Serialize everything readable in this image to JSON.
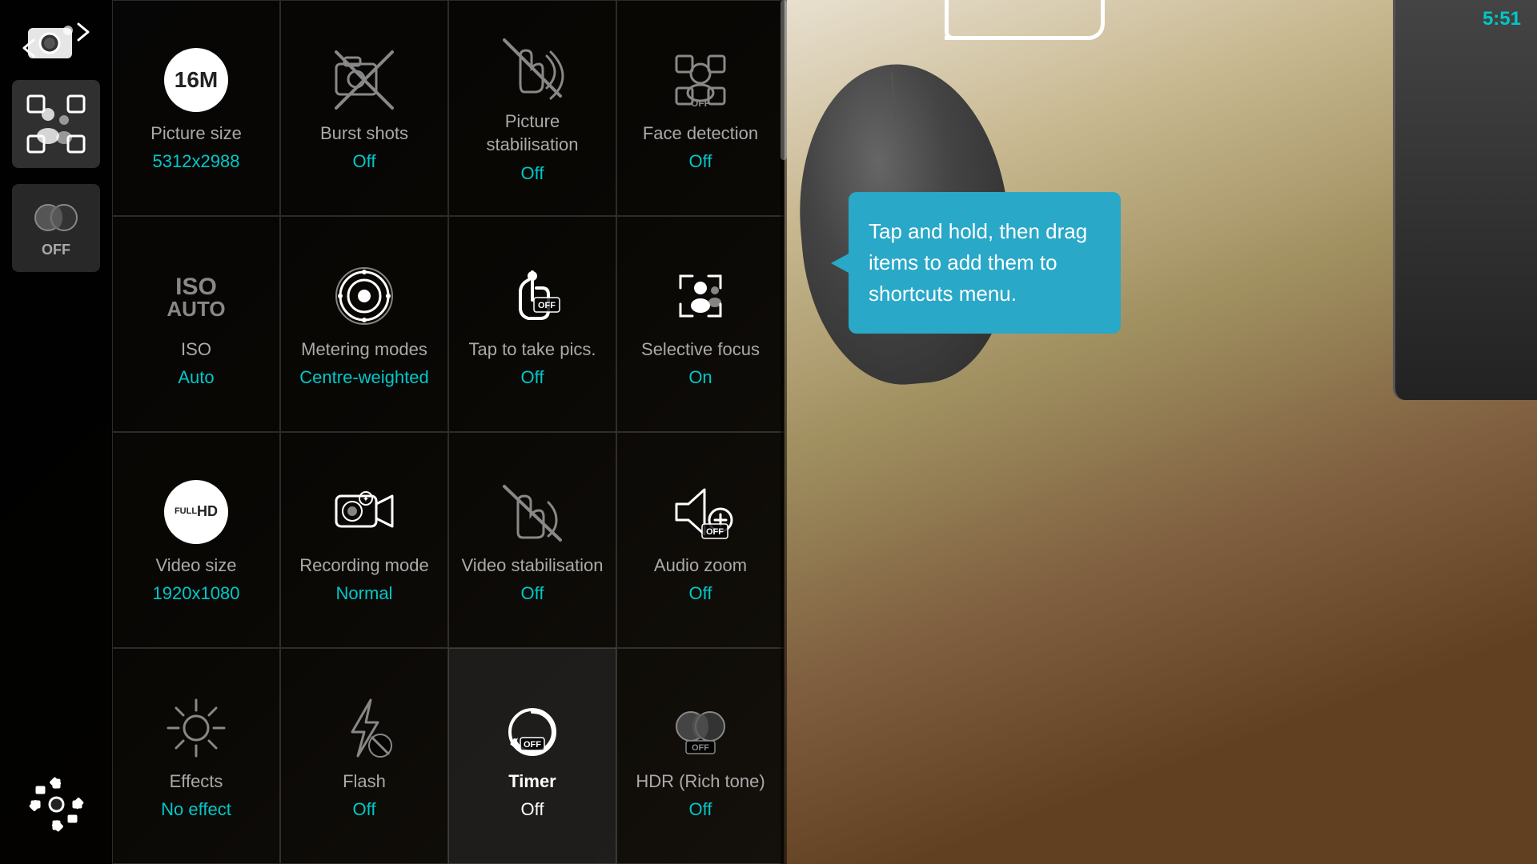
{
  "sidebar": {
    "camera_switch_label": "camera-switch",
    "effects_label": "OFF",
    "settings_label": "settings"
  },
  "grid": {
    "cells": [
      {
        "id": "picture-size",
        "label": "Picture size",
        "value": "5312x2988",
        "icon_type": "16m-badge",
        "value_color": "cyan"
      },
      {
        "id": "burst-shots",
        "label": "Burst shots",
        "value": "Off",
        "icon_type": "burst-shots-off",
        "value_color": "cyan"
      },
      {
        "id": "picture-stabilisation",
        "label": "Picture stabilisation",
        "value": "Off",
        "icon_type": "stabilisation-off",
        "value_color": "cyan"
      },
      {
        "id": "face-detection",
        "label": "Face detection",
        "value": "Off",
        "icon_type": "face-detection-off",
        "value_color": "cyan"
      },
      {
        "id": "iso",
        "label": "ISO",
        "value": "Auto",
        "icon_type": "iso-auto",
        "value_color": "cyan"
      },
      {
        "id": "metering-modes",
        "label": "Metering modes",
        "value": "Centre-weighted",
        "icon_type": "metering",
        "value_color": "cyan"
      },
      {
        "id": "tap-to-take",
        "label": "Tap to take pics.",
        "value": "Off",
        "icon_type": "tap-off",
        "value_color": "cyan"
      },
      {
        "id": "selective-focus",
        "label": "Selective focus",
        "value": "On",
        "icon_type": "selective-focus-on",
        "value_color": "cyan"
      },
      {
        "id": "video-size",
        "label": "Video size",
        "value": "1920x1080",
        "icon_type": "full-hd",
        "value_color": "cyan"
      },
      {
        "id": "recording-mode",
        "label": "Recording mode",
        "value": "Normal",
        "icon_type": "recording",
        "value_color": "cyan"
      },
      {
        "id": "video-stabilisation",
        "label": "Video stabilisation",
        "value": "Off",
        "icon_type": "video-stab-off",
        "value_color": "cyan"
      },
      {
        "id": "audio-zoom",
        "label": "Audio zoom",
        "value": "Off",
        "icon_type": "audio-zoom-off",
        "value_color": "cyan"
      },
      {
        "id": "effects",
        "label": "Effects",
        "value": "No effect",
        "icon_type": "effects-off",
        "value_color": "cyan"
      },
      {
        "id": "flash",
        "label": "Flash",
        "value": "Off",
        "icon_type": "flash-off",
        "value_color": "cyan"
      },
      {
        "id": "timer",
        "label": "Timer",
        "value": "Off",
        "icon_type": "timer-off",
        "value_color": "white"
      },
      {
        "id": "hdr",
        "label": "HDR (Rich tone)",
        "value": "Off",
        "icon_type": "hdr-off",
        "value_color": "cyan"
      }
    ]
  },
  "tooltip": {
    "text": "Tap and hold, then drag items to add them to shortcuts menu."
  }
}
